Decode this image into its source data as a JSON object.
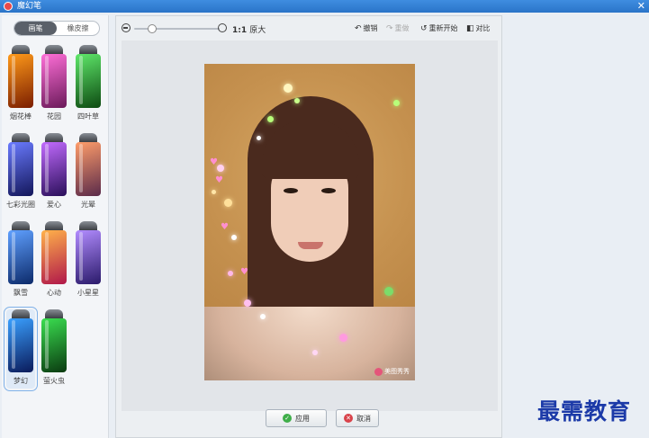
{
  "window": {
    "title": "魔幻笔",
    "close_label": "✕"
  },
  "left": {
    "tabs": [
      {
        "label": "画笔",
        "active": true
      },
      {
        "label": "橡皮擦",
        "active": false
      }
    ],
    "brushes": [
      {
        "label": "烟花棒",
        "colors": [
          "#ff9a1a",
          "#7a1d00"
        ]
      },
      {
        "label": "花园",
        "colors": [
          "#ff6fd8",
          "#6b1a5a"
        ]
      },
      {
        "label": "四叶草",
        "colors": [
          "#5fe86a",
          "#0d4a12"
        ]
      },
      {
        "label": "七彩光圈",
        "colors": [
          "#6a7bff",
          "#13165a"
        ]
      },
      {
        "label": "爱心",
        "colors": [
          "#c26bff",
          "#2a0f5a"
        ]
      },
      {
        "label": "光晕",
        "colors": [
          "#ff9d6a",
          "#5a2a4a"
        ]
      },
      {
        "label": "飘雪",
        "colors": [
          "#5fa0ff",
          "#0c2a6a"
        ]
      },
      {
        "label": "心动",
        "colors": [
          "#ffb24a",
          "#b0174a"
        ]
      },
      {
        "label": "小星星",
        "colors": [
          "#b28cff",
          "#2a1a6a"
        ]
      },
      {
        "label": "梦幻",
        "colors": [
          "#3aa0ff",
          "#0a1a5a"
        ],
        "selected": true
      },
      {
        "label": "萤火虫",
        "colors": [
          "#3adf50",
          "#0a3a10"
        ]
      }
    ]
  },
  "toolbar": {
    "ratio": "1:1",
    "ratio_label": "原大",
    "undo": "撤销",
    "redo": "重做",
    "restart": "重新开始",
    "compare": "对比"
  },
  "photo": {
    "watermark": "美图秀秀"
  },
  "footer": {
    "apply": "应用",
    "cancel": "取消"
  },
  "brand": "最需教育",
  "colors": {
    "titlebar": "#2a74c8",
    "brand": "#1c3aa8"
  }
}
